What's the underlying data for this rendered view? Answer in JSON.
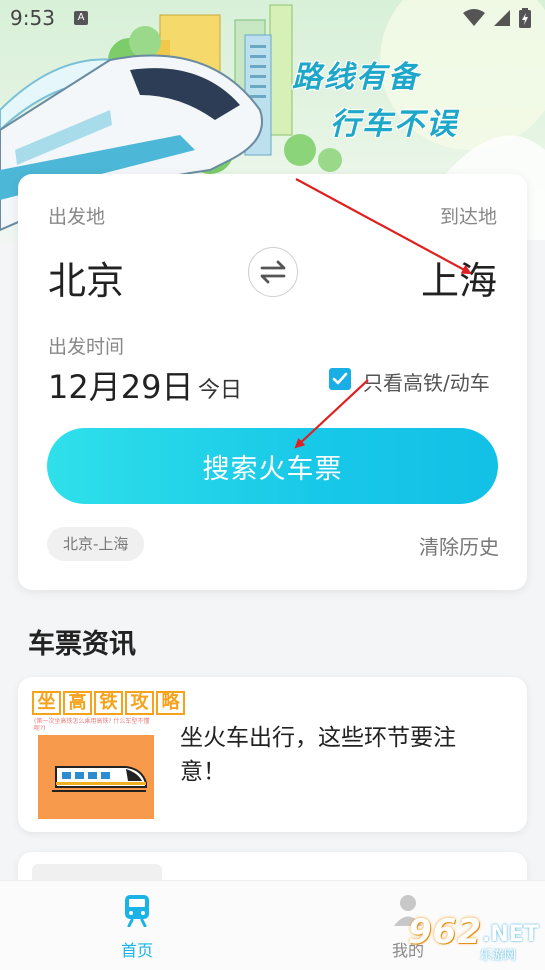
{
  "status_bar": {
    "time": "9:53",
    "notification_icon": "A"
  },
  "banner": {
    "line1": "路线有备",
    "line2": "行车不误"
  },
  "search_card": {
    "from_label": "出发地",
    "to_label": "到达地",
    "from_city": "北京",
    "to_city": "上海",
    "date_label": "出发时间",
    "date": "12月29日",
    "day": "今日",
    "highspeed_label": "只看高铁/动车",
    "highspeed_checked": true,
    "search_button": "搜索火车票",
    "history_chip": "北京-上海",
    "clear_history": "清除历史"
  },
  "news": {
    "section_title": "车票资讯",
    "items": [
      {
        "thumb_title": [
          "坐",
          "高",
          "铁",
          "攻",
          "略"
        ],
        "thumb_sub": "(第一次坐高铁怎么乘用高铁? 什么车型不懂呢?)",
        "title": "坐火车出行，这些环节要注意！"
      }
    ]
  },
  "bottom_nav": {
    "home": "首页",
    "mine": "我的"
  },
  "watermark": {
    "main": "962",
    "net": ".NET",
    "sub": "乐游网"
  },
  "colors": {
    "accent": "#1ab3e6",
    "arrow": "#e02020",
    "banner_text": "#1ea7c9"
  }
}
